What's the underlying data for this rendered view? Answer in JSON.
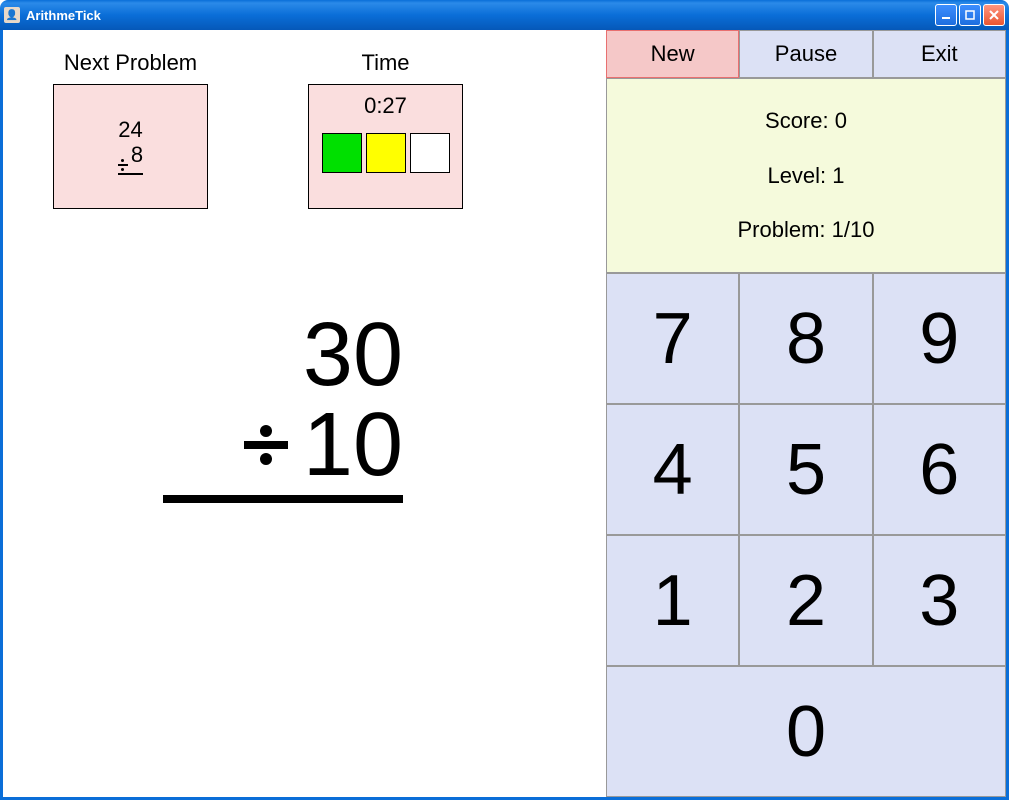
{
  "window": {
    "title": "ArithmeTick"
  },
  "next_problem": {
    "label": "Next Problem",
    "top": "24",
    "bottom": "8",
    "operator": "divide"
  },
  "time": {
    "label": "Time",
    "value": "0:27",
    "indicators": [
      "green",
      "yellow",
      "white"
    ]
  },
  "current_problem": {
    "top": "30",
    "bottom": "10",
    "operator": "divide"
  },
  "actions": {
    "new": "New",
    "pause": "Pause",
    "exit": "Exit"
  },
  "stats": {
    "score_label": "Score:",
    "score_value": "0",
    "level_label": "Level:",
    "level_value": "1",
    "problem_label": "Problem:",
    "problem_value": "1/10"
  },
  "keypad": {
    "k7": "7",
    "k8": "8",
    "k9": "9",
    "k4": "4",
    "k5": "5",
    "k6": "6",
    "k1": "1",
    "k2": "2",
    "k3": "3",
    "k0": "0"
  }
}
